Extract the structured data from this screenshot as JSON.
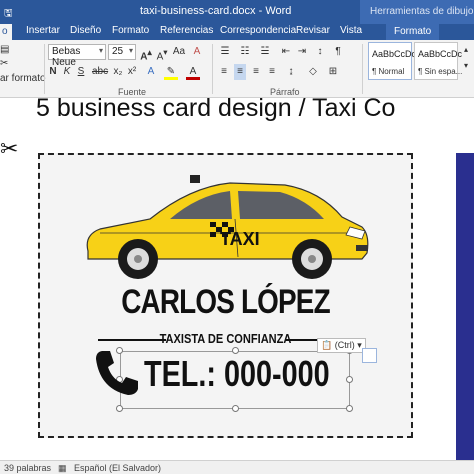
{
  "window": {
    "title": "taxi-business-card.docx - Word",
    "context_group": "Herramientas de dibujo"
  },
  "tabs": [
    {
      "label": "o",
      "active": true
    },
    {
      "label": "Insertar"
    },
    {
      "label": "Diseño"
    },
    {
      "label": "Formato"
    },
    {
      "label": "Referencias"
    },
    {
      "label": "Correspondencia"
    },
    {
      "label": "Revisar"
    },
    {
      "label": "Vista"
    },
    {
      "label": "Formato",
      "contextual": true
    }
  ],
  "ribbon": {
    "font_name": "Bebas Neue",
    "font_size": "25",
    "clipboard_partial": "ar formato",
    "group_font": "Fuente",
    "group_paragraph": "Párrafo",
    "styles": [
      {
        "preview": "AaBbCcDc",
        "name": "¶ Normal",
        "selected": true
      },
      {
        "preview": "AaBbCcDc",
        "name": "¶ Sin espa..."
      }
    ]
  },
  "document": {
    "heading": "5 business card design / Taxi Co",
    "card": {
      "taxi_sign": "TAXI",
      "name": "CARLOS LÓPEZ",
      "subtitle": "TAXISTA DE CONFIANZA",
      "phone": "TEL.: 000-000",
      "paste_options": "(Ctrl)"
    }
  },
  "statusbar": {
    "words": "39 palabras",
    "language": "Español (El Salvador)"
  },
  "colors": {
    "word_blue": "#2b579a",
    "taxi_yellow": "#f7d117",
    "card_blue": "#2a2f8f"
  }
}
